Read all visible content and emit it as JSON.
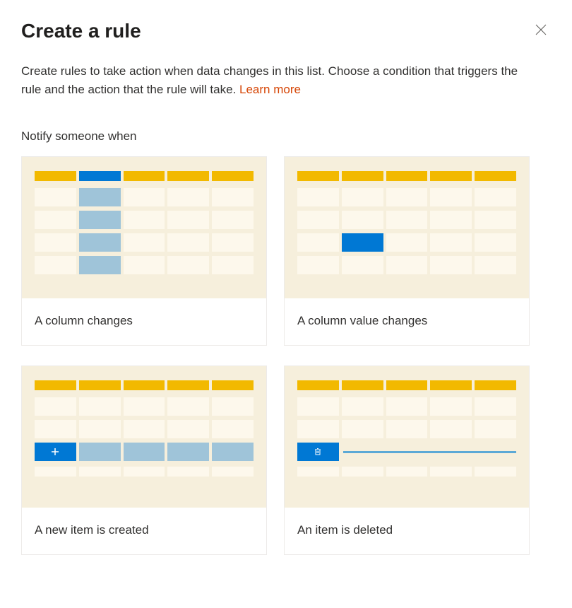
{
  "header": {
    "title": "Create a rule"
  },
  "description": {
    "text": "Create rules to take action when data changes in this list. Choose a condition that triggers the rule and the action that the rule will take. ",
    "learn_more": "Learn more"
  },
  "section": {
    "heading": "Notify someone when"
  },
  "cards": {
    "column_changes": "A column changes",
    "column_value_changes": "A column value changes",
    "new_item_created": "A new item is created",
    "item_deleted": "An item is deleted"
  }
}
